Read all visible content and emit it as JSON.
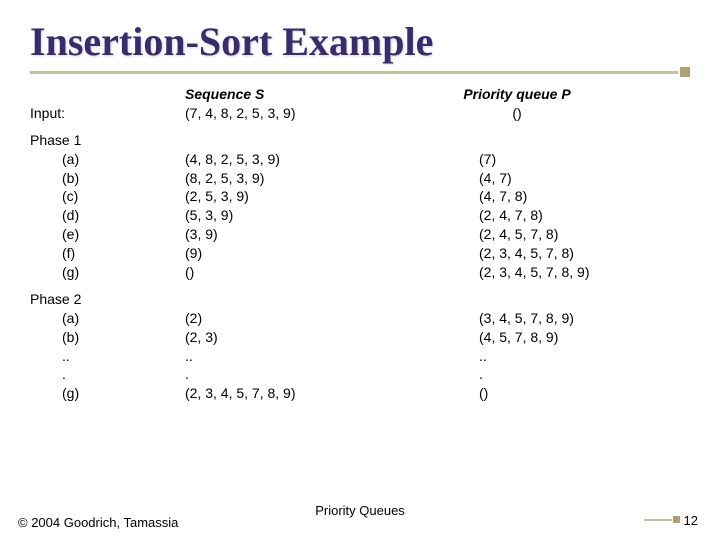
{
  "title": "Insertion-Sort Example",
  "headers": {
    "seq_title_italic": "Sequence S",
    "pri_title_italic": "Priority queue P"
  },
  "input": {
    "label": "Input:",
    "seq": "(7, 4, 8, 2, 5, 3, 9)",
    "pri": "()"
  },
  "phase1": {
    "label": "Phase 1",
    "rows": [
      {
        "key": "(a)",
        "seq": "(4, 8, 2, 5, 3, 9)",
        "pri": "(7)"
      },
      {
        "key": "(b)",
        "seq": "(8, 2, 5, 3, 9)",
        "pri": "(4, 7)"
      },
      {
        "key": "(c)",
        "seq": "(2, 5, 3, 9)",
        "pri": "(4, 7, 8)"
      },
      {
        "key": "(d)",
        "seq": "(5, 3, 9)",
        "pri": "(2, 4, 7, 8)"
      },
      {
        "key": "(e)",
        "seq": "(3, 9)",
        "pri": "(2, 4, 5, 7, 8)"
      },
      {
        "key": "(f)",
        "seq": "(9)",
        "pri": "(2, 3, 4, 5, 7, 8)"
      },
      {
        "key": "(g)",
        "seq": "()",
        "pri": "(2, 3, 4, 5, 7, 8, 9)"
      }
    ]
  },
  "phase2": {
    "label": "Phase 2",
    "rows": [
      {
        "key": "(a)",
        "seq": "(2)",
        "pri": "(3, 4, 5, 7, 8, 9)"
      },
      {
        "key": "(b)",
        "seq": "(2, 3)",
        "pri": "(4, 5, 7, 8, 9)"
      },
      {
        "key": "..",
        "seq": "..",
        "pri": ".."
      },
      {
        "key": ".",
        "seq": ".",
        "pri": "."
      },
      {
        "key": "(g)",
        "seq": "(2, 3, 4, 5, 7, 8, 9)",
        "pri": "()"
      }
    ]
  },
  "footer": {
    "copyright": "© 2004 Goodrich, Tamassia",
    "center": "Priority Queues",
    "page": "12"
  }
}
